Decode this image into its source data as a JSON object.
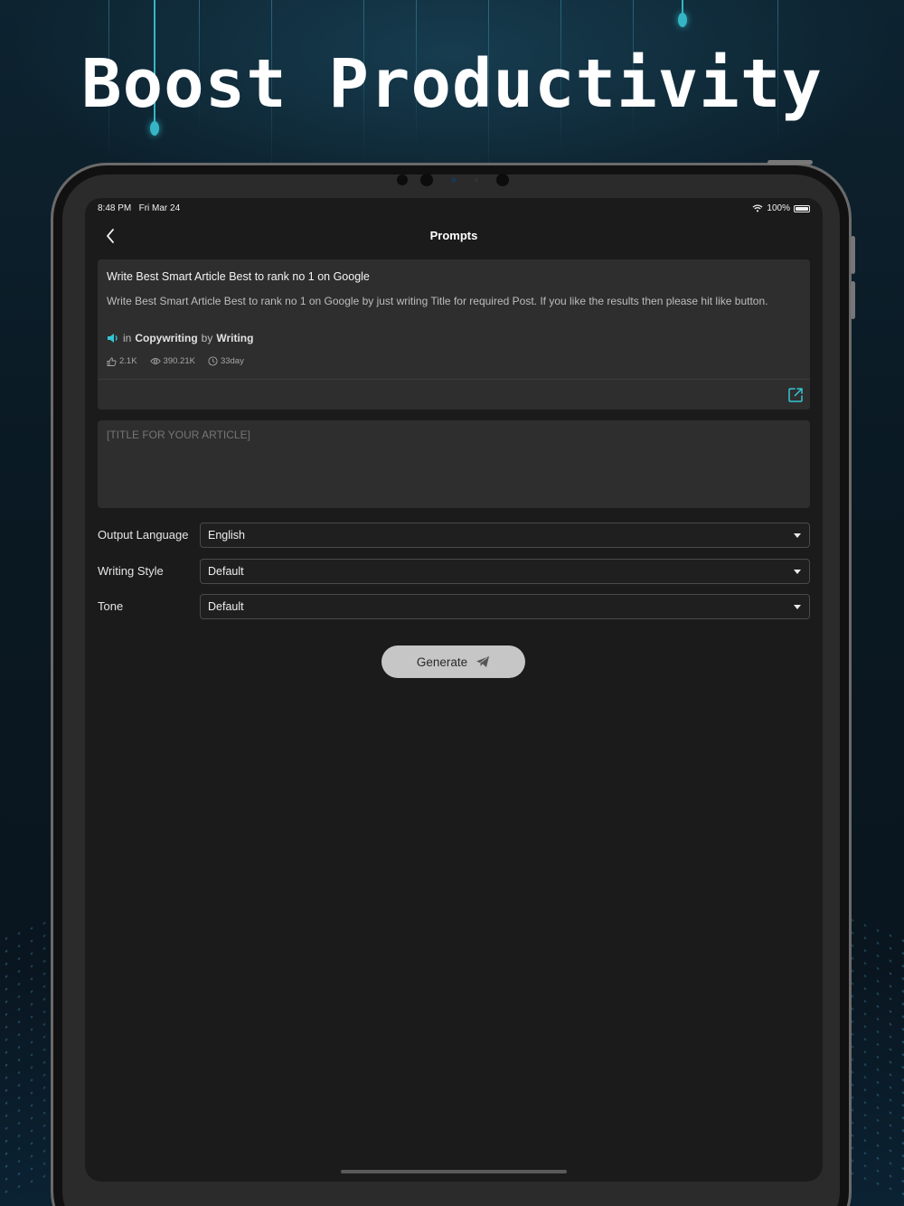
{
  "headline": "Boost Productivity",
  "status_bar": {
    "time": "8:48 PM",
    "date": "Fri Mar 24",
    "battery": "100%"
  },
  "nav": {
    "title": "Prompts",
    "back_icon": "chevron-left-icon"
  },
  "prompt_card": {
    "title": "Write Best Smart Article Best to rank no 1 on Google",
    "description": "Write Best Smart Article Best to rank no 1 on Google by just writing Title for required Post. If you like the results then please hit like button.",
    "meta_in": "in",
    "category": "Copywriting",
    "meta_by": "by",
    "author": "Writing",
    "likes": "2.1K",
    "views": "390.21K",
    "age": "33day",
    "accent_color": "#35c6d6"
  },
  "input": {
    "placeholder": "[TITLE FOR YOUR ARTICLE]"
  },
  "settings": {
    "output_language": {
      "label": "Output Language",
      "value": "English"
    },
    "writing_style": {
      "label": "Writing Style",
      "value": "Default"
    },
    "tone": {
      "label": "Tone",
      "value": "Default"
    }
  },
  "generate_button": {
    "label": "Generate",
    "icon": "send-icon"
  }
}
